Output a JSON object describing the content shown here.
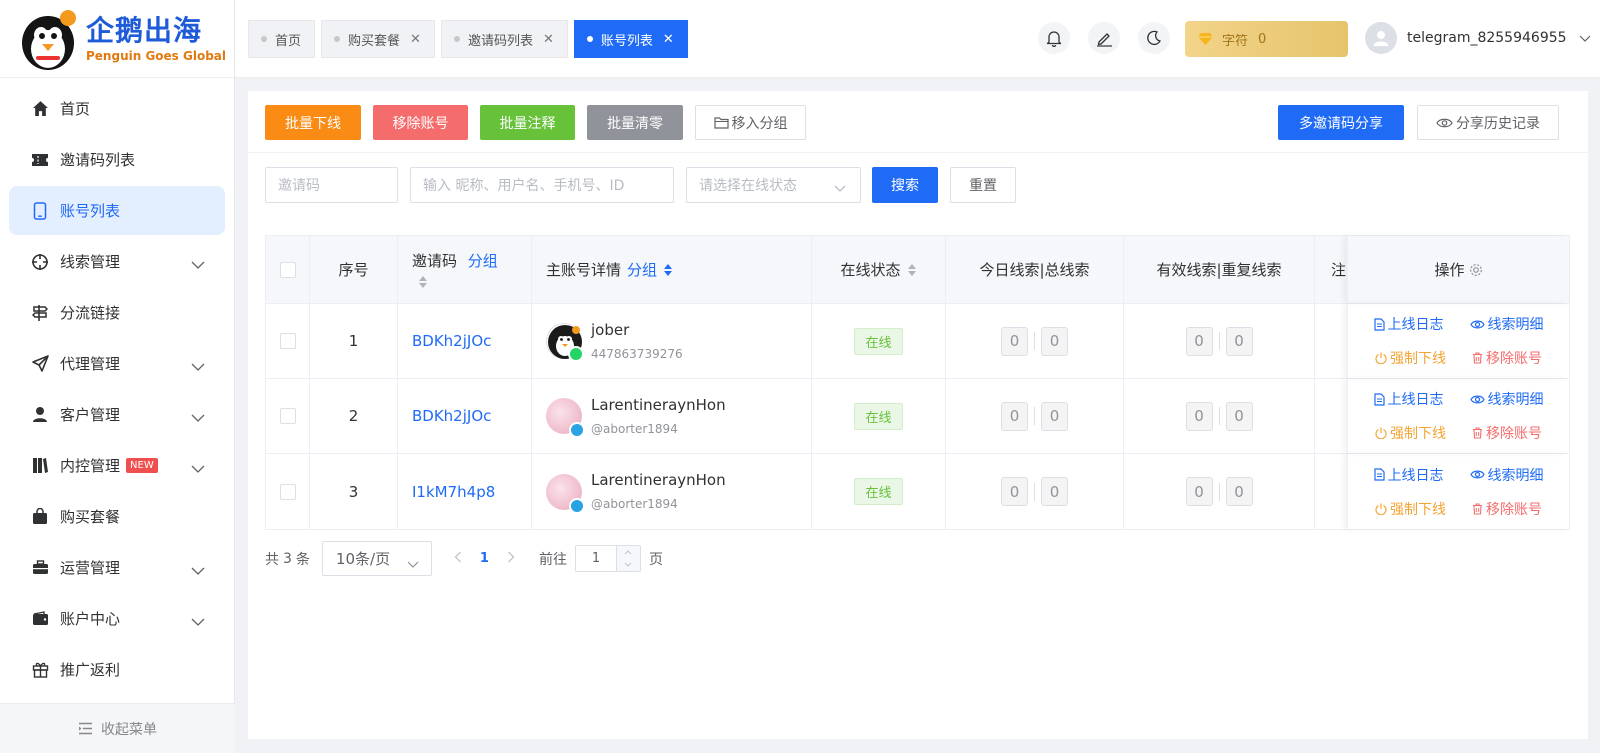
{
  "brand": {
    "title": "企鹅出海",
    "subtitle": "Penguin Goes Global"
  },
  "sidebar": {
    "items": [
      {
        "label": "首页",
        "icon": "home-icon"
      },
      {
        "label": "邀请码列表",
        "icon": "ticket-icon"
      },
      {
        "label": "账号列表",
        "icon": "phone-icon",
        "active": true
      },
      {
        "label": "线索管理",
        "icon": "crosshair-icon",
        "expandable": true
      },
      {
        "label": "分流链接",
        "icon": "signpost-icon"
      },
      {
        "label": "代理管理",
        "icon": "send-icon",
        "expandable": true
      },
      {
        "label": "客户管理",
        "icon": "user-icon",
        "expandable": true
      },
      {
        "label": "内控管理",
        "icon": "book-icon",
        "expandable": true,
        "badge": "NEW"
      },
      {
        "label": "购买套餐",
        "icon": "bag-icon"
      },
      {
        "label": "运营管理",
        "icon": "briefcase-icon",
        "expandable": true
      },
      {
        "label": "账户中心",
        "icon": "wallet-icon",
        "expandable": true
      },
      {
        "label": "推广返利",
        "icon": "gift-icon"
      }
    ],
    "collapse_label": "收起菜单"
  },
  "tabs": [
    {
      "label": "首页",
      "closable": false
    },
    {
      "label": "购买套餐",
      "closable": true
    },
    {
      "label": "邀请码列表",
      "closable": true
    },
    {
      "label": "账号列表",
      "closable": true,
      "active": true
    }
  ],
  "header": {
    "coin_label": "字符",
    "coin_value": "0",
    "username": "telegram_8255946955"
  },
  "toolbar": {
    "batch_offline": "批量下线",
    "remove_account": "移除账号",
    "batch_comment": "批量注释",
    "batch_clear": "批量清零",
    "move_group": "移入分组",
    "multi_share": "多邀请码分享",
    "share_history": "分享历史记录"
  },
  "filters": {
    "invite_placeholder": "邀请码",
    "keyword_placeholder": "输入 昵称、用户名、手机号、ID",
    "status_placeholder": "请选择在线状态",
    "search_label": "搜索",
    "reset_label": "重置"
  },
  "table": {
    "headers": {
      "index": "序号",
      "invite_code": "邀请码",
      "group": "分组",
      "account": "主账号详情",
      "status": "在线状态",
      "today_total": "今日线索|总线索",
      "valid_dup": "有效线索|重复线索",
      "note": "注",
      "ops": "操作"
    },
    "rows": [
      {
        "index": "1",
        "code": "BDKh2jJOc",
        "name": "jober",
        "sub": "447863739276",
        "platform": "whatsapp",
        "status": "在线",
        "today": "0",
        "total": "0",
        "valid": "0",
        "dup": "0"
      },
      {
        "index": "2",
        "code": "BDKh2jJOc",
        "name": "LarentineraynHon",
        "sub": "@aborter1894",
        "platform": "telegram",
        "status": "在线",
        "today": "0",
        "total": "0",
        "valid": "0",
        "dup": "0"
      },
      {
        "index": "3",
        "code": "I1kM7h4p8",
        "name": "LarentineraynHon",
        "sub": "@aborter1894",
        "platform": "telegram",
        "status": "在线",
        "today": "0",
        "total": "0",
        "valid": "0",
        "dup": "0"
      }
    ],
    "ops": {
      "log": "上线日志",
      "detail": "线索明细",
      "force_offline": "强制下线",
      "remove": "移除账号"
    }
  },
  "pagination": {
    "total_prefix": "共",
    "total": "3",
    "total_suffix": "条",
    "page_size": "10条/页",
    "current": "1",
    "goto_prefix": "前往",
    "goto_value": "1",
    "goto_suffix": "页"
  },
  "colors": {
    "primary": "#1f6bf5",
    "orange": "#fa8c16",
    "red": "#f56c6c",
    "green": "#67c23a",
    "gray": "#909399"
  }
}
